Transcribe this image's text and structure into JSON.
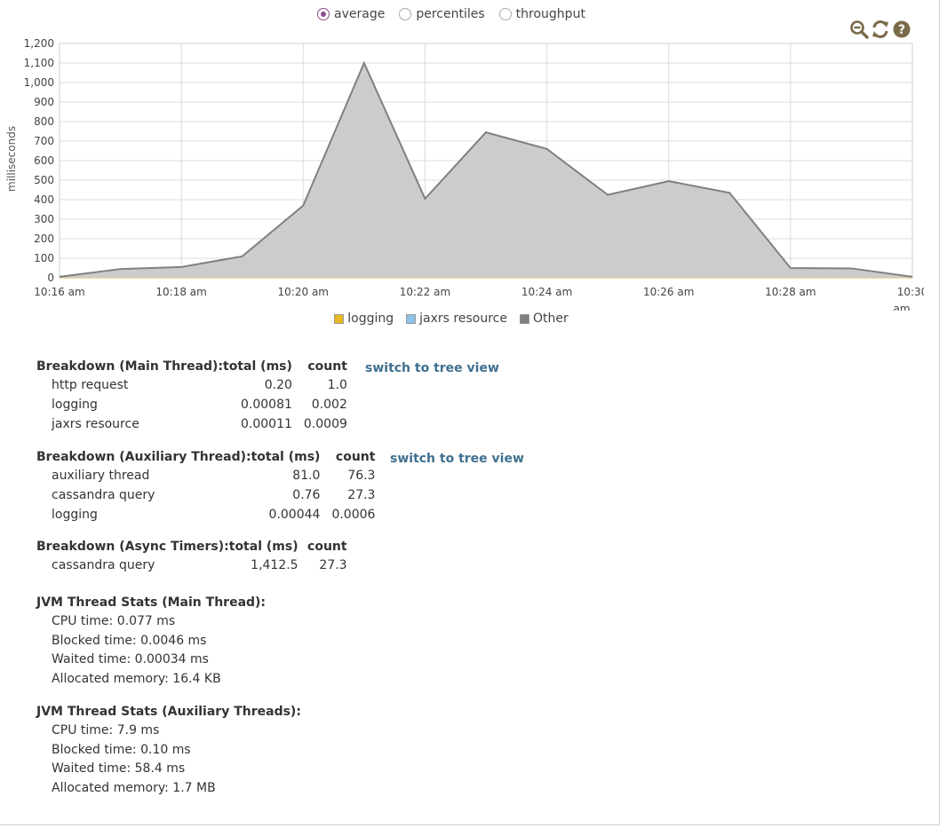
{
  "radios": [
    {
      "label": "average",
      "checked": true
    },
    {
      "label": "percentiles",
      "checked": false
    },
    {
      "label": "throughput",
      "checked": false
    }
  ],
  "tools": [
    "zoom-out-icon",
    "refresh-icon",
    "help-icon"
  ],
  "chart_data": {
    "type": "area",
    "ylabel": "milliseconds",
    "ylim": [
      0,
      1200
    ],
    "yticks": [
      "0",
      "100",
      "200",
      "300",
      "400",
      "500",
      "600",
      "700",
      "800",
      "900",
      "1,000",
      "1,100",
      "1,200"
    ],
    "xticks": [
      "10:16 am",
      "10:18 am",
      "10:20 am",
      "10:22 am",
      "10:24 am",
      "10:26 am",
      "10:28 am",
      "10:30 am"
    ],
    "x": [
      "10:16",
      "10:17",
      "10:18",
      "10:19",
      "10:20",
      "10:21",
      "10:22",
      "10:23",
      "10:24",
      "10:25",
      "10:26",
      "10:27",
      "10:28",
      "10:29",
      "10:30"
    ],
    "series": [
      {
        "name": "logging",
        "color": "#e8b824",
        "values": [
          0,
          0,
          0,
          0,
          0,
          0,
          0,
          0,
          0,
          0,
          0,
          0,
          0,
          0,
          0
        ]
      },
      {
        "name": "jaxrs resource",
        "color": "#8fc3e8",
        "values": [
          0,
          0,
          0,
          0,
          0,
          0,
          0,
          0,
          0,
          0,
          0,
          0,
          0,
          0,
          0
        ]
      },
      {
        "name": "Other",
        "color": "#808080",
        "values": [
          5,
          45,
          55,
          110,
          370,
          1100,
          405,
          745,
          660,
          425,
          495,
          435,
          50,
          48,
          5
        ]
      }
    ],
    "grid": true,
    "legend": "bottom"
  },
  "main_breakdown": {
    "title": "Breakdown (Main Thread):",
    "col_total": "total (ms)",
    "col_count": "count",
    "rows": [
      {
        "name": "http request",
        "total": "0.20",
        "count": "1.0"
      },
      {
        "name": "logging",
        "total": "0.00081",
        "count": "0.002"
      },
      {
        "name": "jaxrs resource",
        "total": "0.00011",
        "count": "0.0009"
      }
    ],
    "link": "switch to tree view"
  },
  "aux_breakdown": {
    "title": "Breakdown (Auxiliary Thread):",
    "col_total": "total (ms)",
    "col_count": "count",
    "rows": [
      {
        "name": "auxiliary thread",
        "total": "81.0",
        "count": "76.3"
      },
      {
        "name": "cassandra query",
        "total": "0.76",
        "count": "27.3"
      },
      {
        "name": "logging",
        "total": "0.00044",
        "count": "0.0006"
      }
    ],
    "link": "switch to tree view"
  },
  "async_breakdown": {
    "title": "Breakdown (Async Timers):",
    "col_total": "total (ms)",
    "col_count": "count",
    "rows": [
      {
        "name": "cassandra query",
        "total": "1,412.5",
        "count": "27.3"
      }
    ]
  },
  "jvm_main": {
    "title": "JVM Thread Stats (Main Thread):",
    "cpu": "CPU time: 0.077 ms",
    "blocked": "Blocked time: 0.0046 ms",
    "waited": "Waited time: 0.00034 ms",
    "alloc": "Allocated memory: 16.4 KB"
  },
  "jvm_aux": {
    "title": "JVM Thread Stats (Auxiliary Threads):",
    "cpu": "CPU time: 7.9 ms",
    "blocked": "Blocked time: 0.10 ms",
    "waited": "Waited time: 58.4 ms",
    "alloc": "Allocated memory: 1.7 MB"
  }
}
